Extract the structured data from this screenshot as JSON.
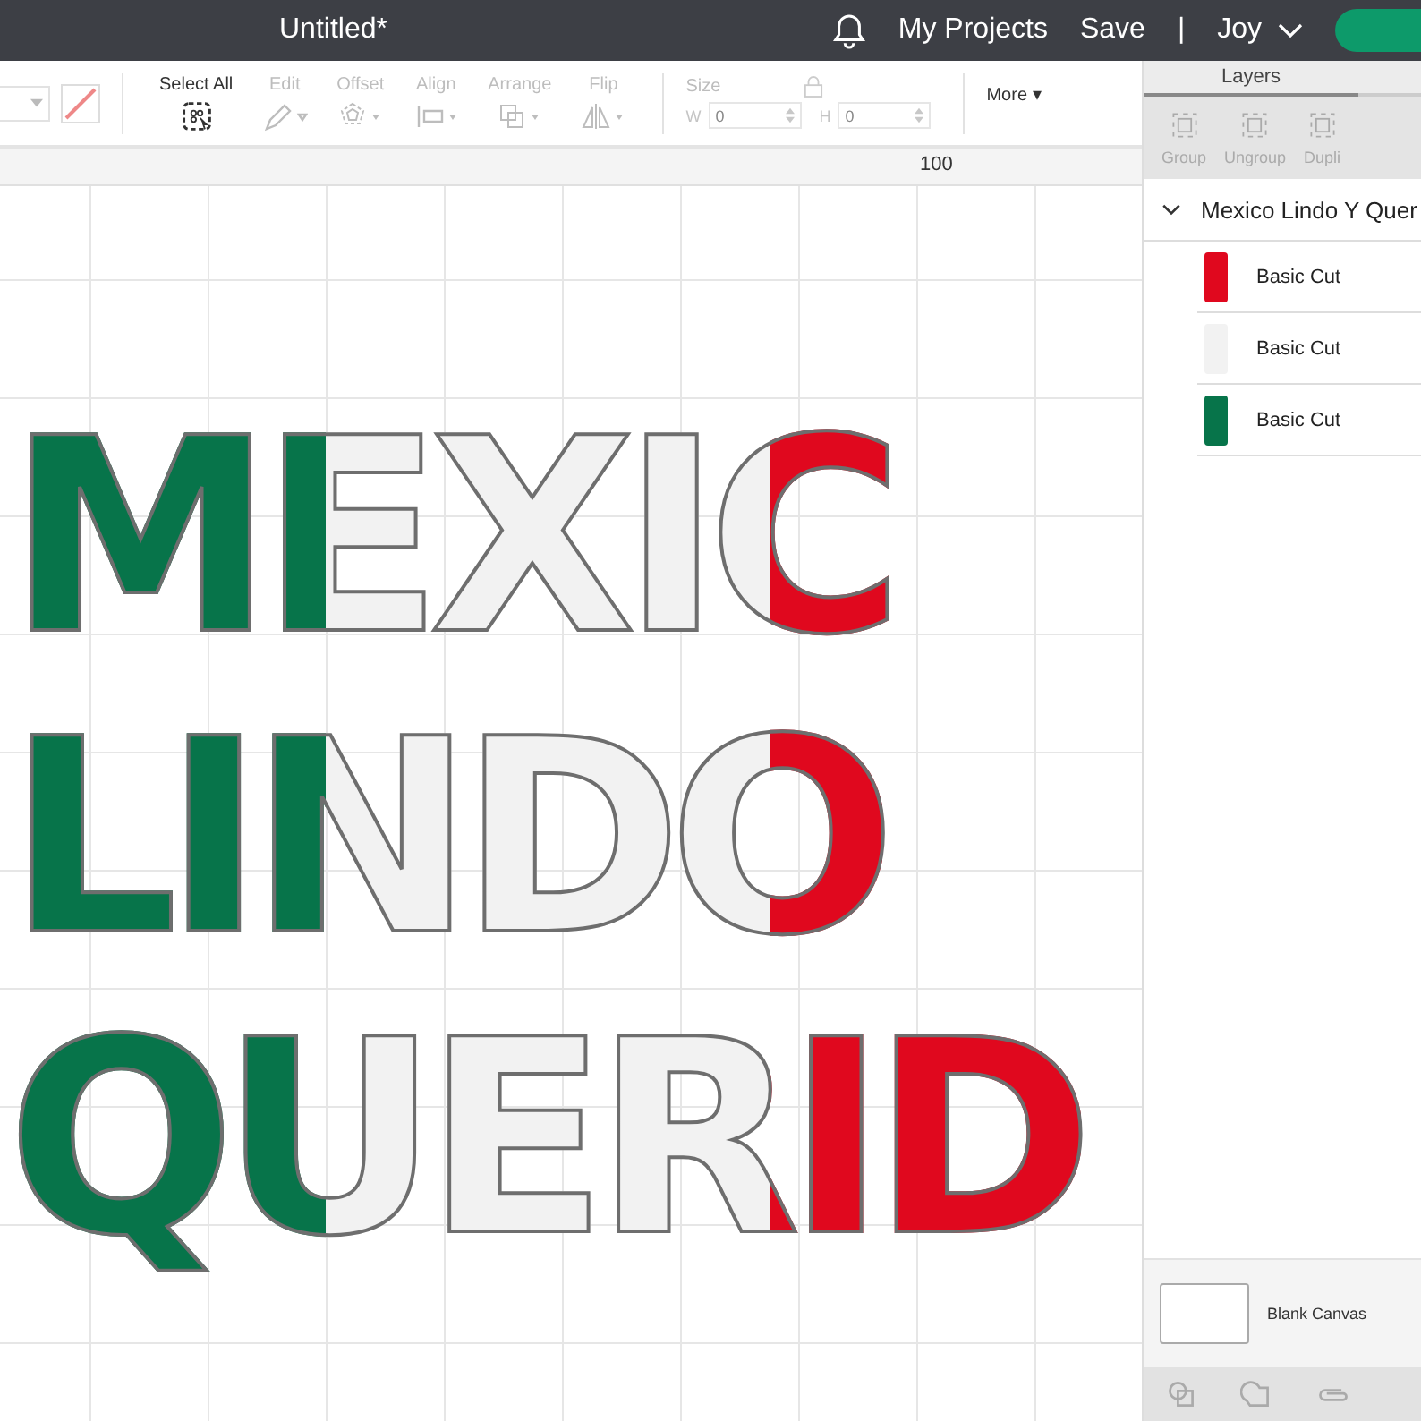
{
  "topbar": {
    "title": "Untitled*",
    "links": [
      "My Projects",
      "Save"
    ],
    "separator": "|",
    "user": "Joy"
  },
  "toolbar": {
    "tools": [
      {
        "label": "Select All",
        "disabled": false
      },
      {
        "label": "Edit",
        "disabled": true
      },
      {
        "label": "Offset",
        "disabled": true
      },
      {
        "label": "Align",
        "disabled": true
      },
      {
        "label": "Arrange",
        "disabled": true
      },
      {
        "label": "Flip",
        "disabled": true
      }
    ],
    "size": {
      "label": "Size",
      "fields": [
        {
          "label": "W",
          "value": "0"
        },
        {
          "label": "H",
          "value": "0"
        }
      ]
    },
    "more": "More ▾"
  },
  "ruler": {
    "label": "100"
  },
  "artwork": [
    "MEXIC",
    "LINDO",
    "QUERID"
  ],
  "panel": {
    "tabs": [
      {
        "label": "Layers",
        "selected": true
      }
    ],
    "actions": [
      "Group",
      "Ungroup",
      "Dupli"
    ],
    "group": {
      "name": "Mexico Lindo Y Quer",
      "expanded": true
    },
    "layers": [
      {
        "name": "Basic Cut",
        "color": "#e0081e"
      },
      {
        "name": "Basic Cut",
        "color": "#f2f2f2"
      },
      {
        "name": "Basic Cut",
        "color": "#07744a"
      }
    ],
    "canvas": "Blank Canvas"
  }
}
